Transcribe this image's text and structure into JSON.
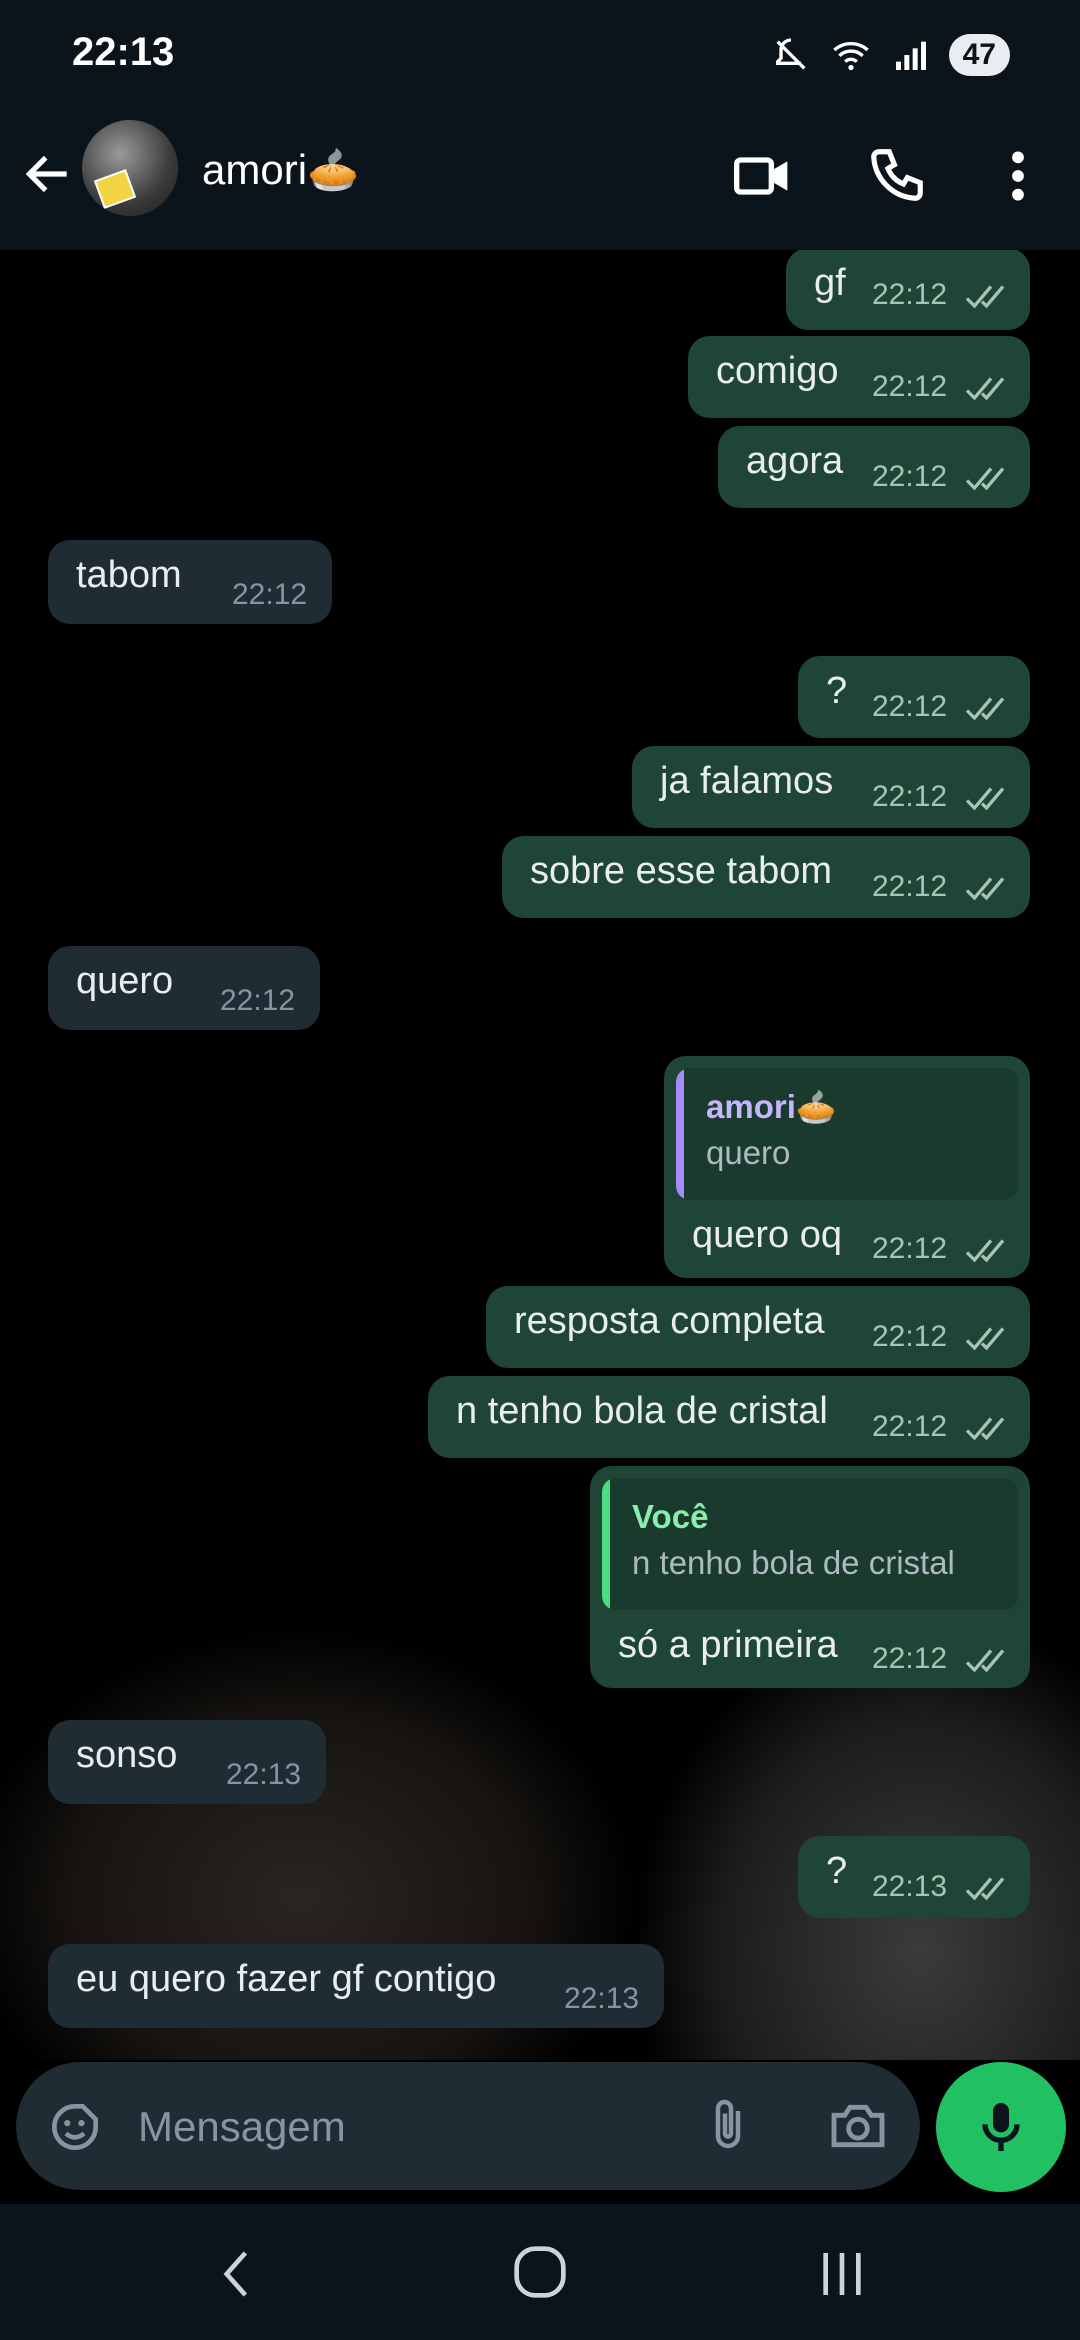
{
  "status": {
    "time": "22:13",
    "battery": "47"
  },
  "header": {
    "contact_name": "amori🥧"
  },
  "messages": [
    {
      "text": "gf",
      "time": "22:12"
    },
    {
      "text": "comigo",
      "time": "22:12"
    },
    {
      "text": "agora",
      "time": "22:12"
    },
    {
      "text": "tabom",
      "time": "22:12"
    },
    {
      "text": "?",
      "time": "22:12"
    },
    {
      "text": "ja falamos",
      "time": "22:12"
    },
    {
      "text": "sobre esse tabom",
      "time": "22:12"
    },
    {
      "text": "quero",
      "time": "22:12"
    },
    {
      "text": "quero oq",
      "time": "22:12",
      "quote_name": "amori🥧",
      "quote_text": "quero"
    },
    {
      "text": "resposta completa",
      "time": "22:12"
    },
    {
      "text": "n tenho bola de cristal",
      "time": "22:12"
    },
    {
      "text": "só a primeira",
      "time": "22:12",
      "quote_name": "Você",
      "quote_text": "n tenho bola de cristal"
    },
    {
      "text": "sonso",
      "time": "22:13"
    },
    {
      "text": "?",
      "time": "22:13"
    },
    {
      "text": "eu quero fazer gf contigo",
      "time": "22:13"
    }
  ],
  "composer": {
    "placeholder": "Mensagem"
  },
  "colors": {
    "outgoing_bubble": "#1e4536",
    "incoming_bubble": "#1f2c34",
    "accent": "#21c063",
    "quote_bar_contact": "#a78bfa",
    "quote_bar_self": "#4ade80"
  }
}
